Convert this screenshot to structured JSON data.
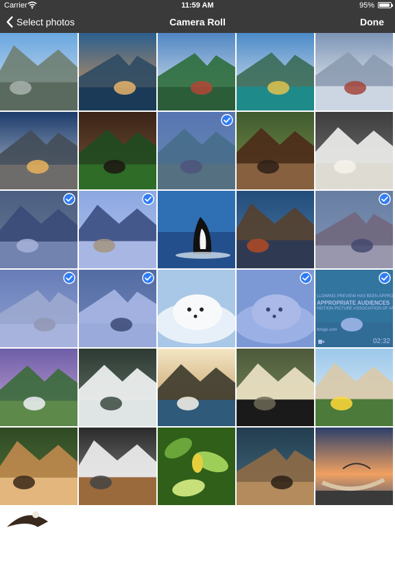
{
  "status_bar": {
    "carrier": "Carrier",
    "time": "11:59 AM",
    "battery_percent": "95%",
    "battery_level": 0.95
  },
  "nav": {
    "back_label": "Select photos",
    "title": "Camera Roll",
    "done_label": "Done"
  },
  "photos": [
    {
      "subject": "mountain-village",
      "selected": false
    },
    {
      "subject": "mountain-lake-sunrise",
      "selected": false
    },
    {
      "subject": "lodge-by-lake",
      "selected": false
    },
    {
      "subject": "lake-canoes",
      "selected": false
    },
    {
      "subject": "snowy-mountain-town",
      "selected": false
    },
    {
      "subject": "town-street-mountain",
      "selected": false
    },
    {
      "subject": "bears-by-cabin",
      "selected": false
    },
    {
      "subject": "grizzly-bear",
      "selected": true
    },
    {
      "subject": "moose-pair",
      "selected": false
    },
    {
      "subject": "polar-bears-play",
      "selected": false
    },
    {
      "subject": "black-and-white-bears",
      "selected": true
    },
    {
      "subject": "penguins",
      "selected": true
    },
    {
      "subject": "orca",
      "selected": false
    },
    {
      "subject": "harlequin-ducks",
      "selected": false
    },
    {
      "subject": "chipmunk",
      "selected": true
    },
    {
      "subject": "polar-bear-cubs",
      "selected": true
    },
    {
      "subject": "snowy-owl",
      "selected": true
    },
    {
      "subject": "harp-seal-pup",
      "selected": false
    },
    {
      "subject": "seal-pup-resting",
      "selected": true
    },
    {
      "subject": "video-preview",
      "selected": true
    },
    {
      "subject": "waterfall-cliffs",
      "selected": false
    },
    {
      "subject": "waterfall-closeup",
      "selected": false
    },
    {
      "subject": "coastal-waterfall",
      "selected": false
    },
    {
      "subject": "bear-cubs",
      "selected": false
    },
    {
      "subject": "beach-flower",
      "selected": false
    },
    {
      "subject": "lynx-kittens",
      "selected": false
    },
    {
      "subject": "puppies",
      "selected": false
    },
    {
      "subject": "green-leaves",
      "selected": false
    },
    {
      "subject": "bear-in-water",
      "selected": false
    },
    {
      "subject": "hammock-sunset",
      "selected": false
    },
    {
      "subject": "eagle",
      "selected": false
    }
  ],
  "video": {
    "rating_lines": [
      "LLOWING PREVIEW HAS BEEN APPROVED",
      "APPROPRIATE AUDIENCES",
      "MOTION PICTURE ASSOCIATION OF AMERICA"
    ],
    "site": "ltrlogo.com",
    "duration": "02:32"
  },
  "colors": {
    "bar": "#3a3a3a",
    "check": "#2f7cf6",
    "selected_tint": "#506ed2"
  }
}
